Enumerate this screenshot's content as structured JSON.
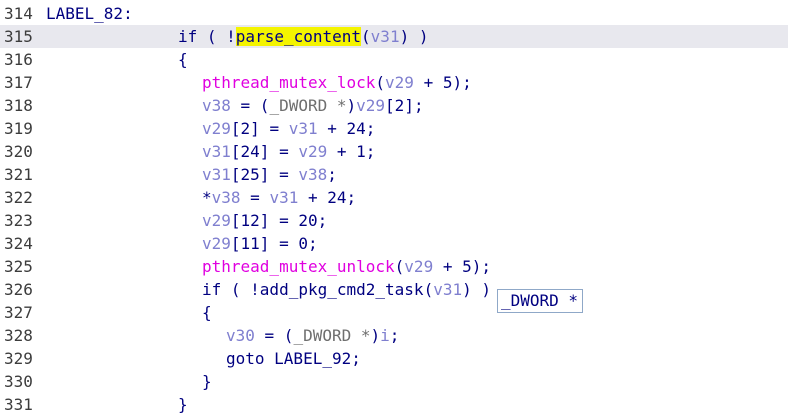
{
  "colors": {
    "current_line_bg": "#e8e8ee",
    "keyword": "#000080",
    "variable": "#7f7fcf",
    "function_call": "#e000e0",
    "type_cast": "#6f6f6f",
    "highlight": "#f4f400"
  },
  "lines": [
    {
      "num": "314",
      "indent": 0,
      "tokens": [
        {
          "t": "LABEL_82:",
          "c": "label"
        }
      ]
    },
    {
      "num": "315",
      "indent": 11,
      "current": true,
      "tokens": [
        {
          "t": "if ( !",
          "c": "kw"
        },
        {
          "t": "parse_content",
          "c": "hl"
        },
        {
          "t": "(",
          "c": "op"
        },
        {
          "t": "v31",
          "c": "var"
        },
        {
          "t": ") )",
          "c": "op"
        }
      ]
    },
    {
      "num": "316",
      "indent": 11,
      "tokens": [
        {
          "t": "{",
          "c": "op"
        }
      ]
    },
    {
      "num": "317",
      "indent": 13,
      "tokens": [
        {
          "t": "pthread_mutex_lock",
          "c": "fn"
        },
        {
          "t": "(",
          "c": "op"
        },
        {
          "t": "v29",
          "c": "var"
        },
        {
          "t": " + 5);",
          "c": "op"
        }
      ]
    },
    {
      "num": "318",
      "indent": 13,
      "tokens": [
        {
          "t": "v38",
          "c": "var"
        },
        {
          "t": " = (",
          "c": "op"
        },
        {
          "t": "_DWORD *",
          "c": "type"
        },
        {
          "t": ")",
          "c": "op"
        },
        {
          "t": "v29",
          "c": "var"
        },
        {
          "t": "[2];",
          "c": "op"
        }
      ]
    },
    {
      "num": "319",
      "indent": 13,
      "tokens": [
        {
          "t": "v29",
          "c": "var"
        },
        {
          "t": "[2] = ",
          "c": "op"
        },
        {
          "t": "v31",
          "c": "var"
        },
        {
          "t": " + 24;",
          "c": "op"
        }
      ]
    },
    {
      "num": "320",
      "indent": 13,
      "tokens": [
        {
          "t": "v31",
          "c": "var"
        },
        {
          "t": "[24] = ",
          "c": "op"
        },
        {
          "t": "v29",
          "c": "var"
        },
        {
          "t": " + 1;",
          "c": "op"
        }
      ]
    },
    {
      "num": "321",
      "indent": 13,
      "tokens": [
        {
          "t": "v31",
          "c": "var"
        },
        {
          "t": "[25] = ",
          "c": "op"
        },
        {
          "t": "v38",
          "c": "var"
        },
        {
          "t": ";",
          "c": "op"
        }
      ]
    },
    {
      "num": "322",
      "indent": 13,
      "tokens": [
        {
          "t": "*",
          "c": "op"
        },
        {
          "t": "v38",
          "c": "var"
        },
        {
          "t": " = ",
          "c": "op"
        },
        {
          "t": "v31",
          "c": "var"
        },
        {
          "t": " + 24;",
          "c": "op"
        }
      ]
    },
    {
      "num": "323",
      "indent": 13,
      "tokens": [
        {
          "t": "v29",
          "c": "var"
        },
        {
          "t": "[12] = 20;",
          "c": "op"
        }
      ]
    },
    {
      "num": "324",
      "indent": 13,
      "tokens": [
        {
          "t": "v29",
          "c": "var"
        },
        {
          "t": "[11] = 0;",
          "c": "op"
        }
      ]
    },
    {
      "num": "325",
      "indent": 13,
      "tokens": [
        {
          "t": "pthread_mutex_unlock",
          "c": "fn"
        },
        {
          "t": "(",
          "c": "op"
        },
        {
          "t": "v29",
          "c": "var"
        },
        {
          "t": " + 5);",
          "c": "op"
        }
      ]
    },
    {
      "num": "326",
      "indent": 13,
      "tokens": [
        {
          "t": "if ( !",
          "c": "kw"
        },
        {
          "t": "add_pkg_cmd2_task",
          "c": "fn-plain"
        },
        {
          "t": "(",
          "c": "op"
        },
        {
          "t": "v31",
          "c": "var"
        },
        {
          "t": ") )",
          "c": "op"
        }
      ]
    },
    {
      "num": "327",
      "indent": 13,
      "tokens": [
        {
          "t": "{",
          "c": "op"
        }
      ]
    },
    {
      "num": "328",
      "indent": 15,
      "tokens": [
        {
          "t": "v30",
          "c": "var"
        },
        {
          "t": " = (",
          "c": "op"
        },
        {
          "t": "_DWORD *",
          "c": "type"
        },
        {
          "t": ")",
          "c": "op"
        },
        {
          "t": "i",
          "c": "var"
        },
        {
          "t": ";",
          "c": "op"
        }
      ]
    },
    {
      "num": "329",
      "indent": 15,
      "tokens": [
        {
          "t": "goto LABEL_92;",
          "c": "kw"
        }
      ]
    },
    {
      "num": "330",
      "indent": 13,
      "tokens": [
        {
          "t": "}",
          "c": "op"
        }
      ]
    },
    {
      "num": "331",
      "indent": 11,
      "tokens": [
        {
          "t": "}",
          "c": "op"
        }
      ]
    }
  ],
  "tooltip": {
    "text": "_DWORD *"
  }
}
